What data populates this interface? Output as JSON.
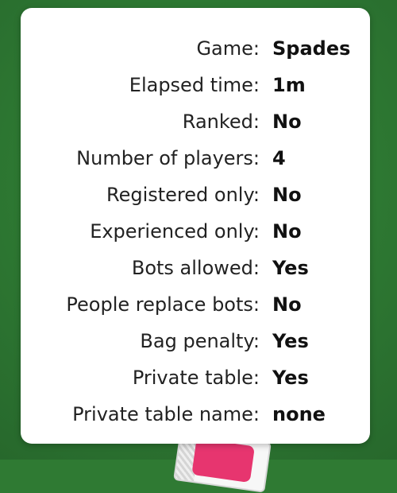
{
  "table_info": {
    "rows": [
      {
        "label": "Game:",
        "value": "Spades"
      },
      {
        "label": "Elapsed time:",
        "value": "1m"
      },
      {
        "label": "Ranked:",
        "value": "No"
      },
      {
        "label": "Number of players:",
        "value": "4"
      },
      {
        "label": "Registered only:",
        "value": "No"
      },
      {
        "label": "Experienced only:",
        "value": "No"
      },
      {
        "label": "Bots allowed:",
        "value": "Yes"
      },
      {
        "label": "People replace bots:",
        "value": "No"
      },
      {
        "label": "Bag penalty:",
        "value": "Yes"
      },
      {
        "label": "Private table:",
        "value": "Yes"
      },
      {
        "label": "Private table name:",
        "value": "none"
      }
    ]
  }
}
